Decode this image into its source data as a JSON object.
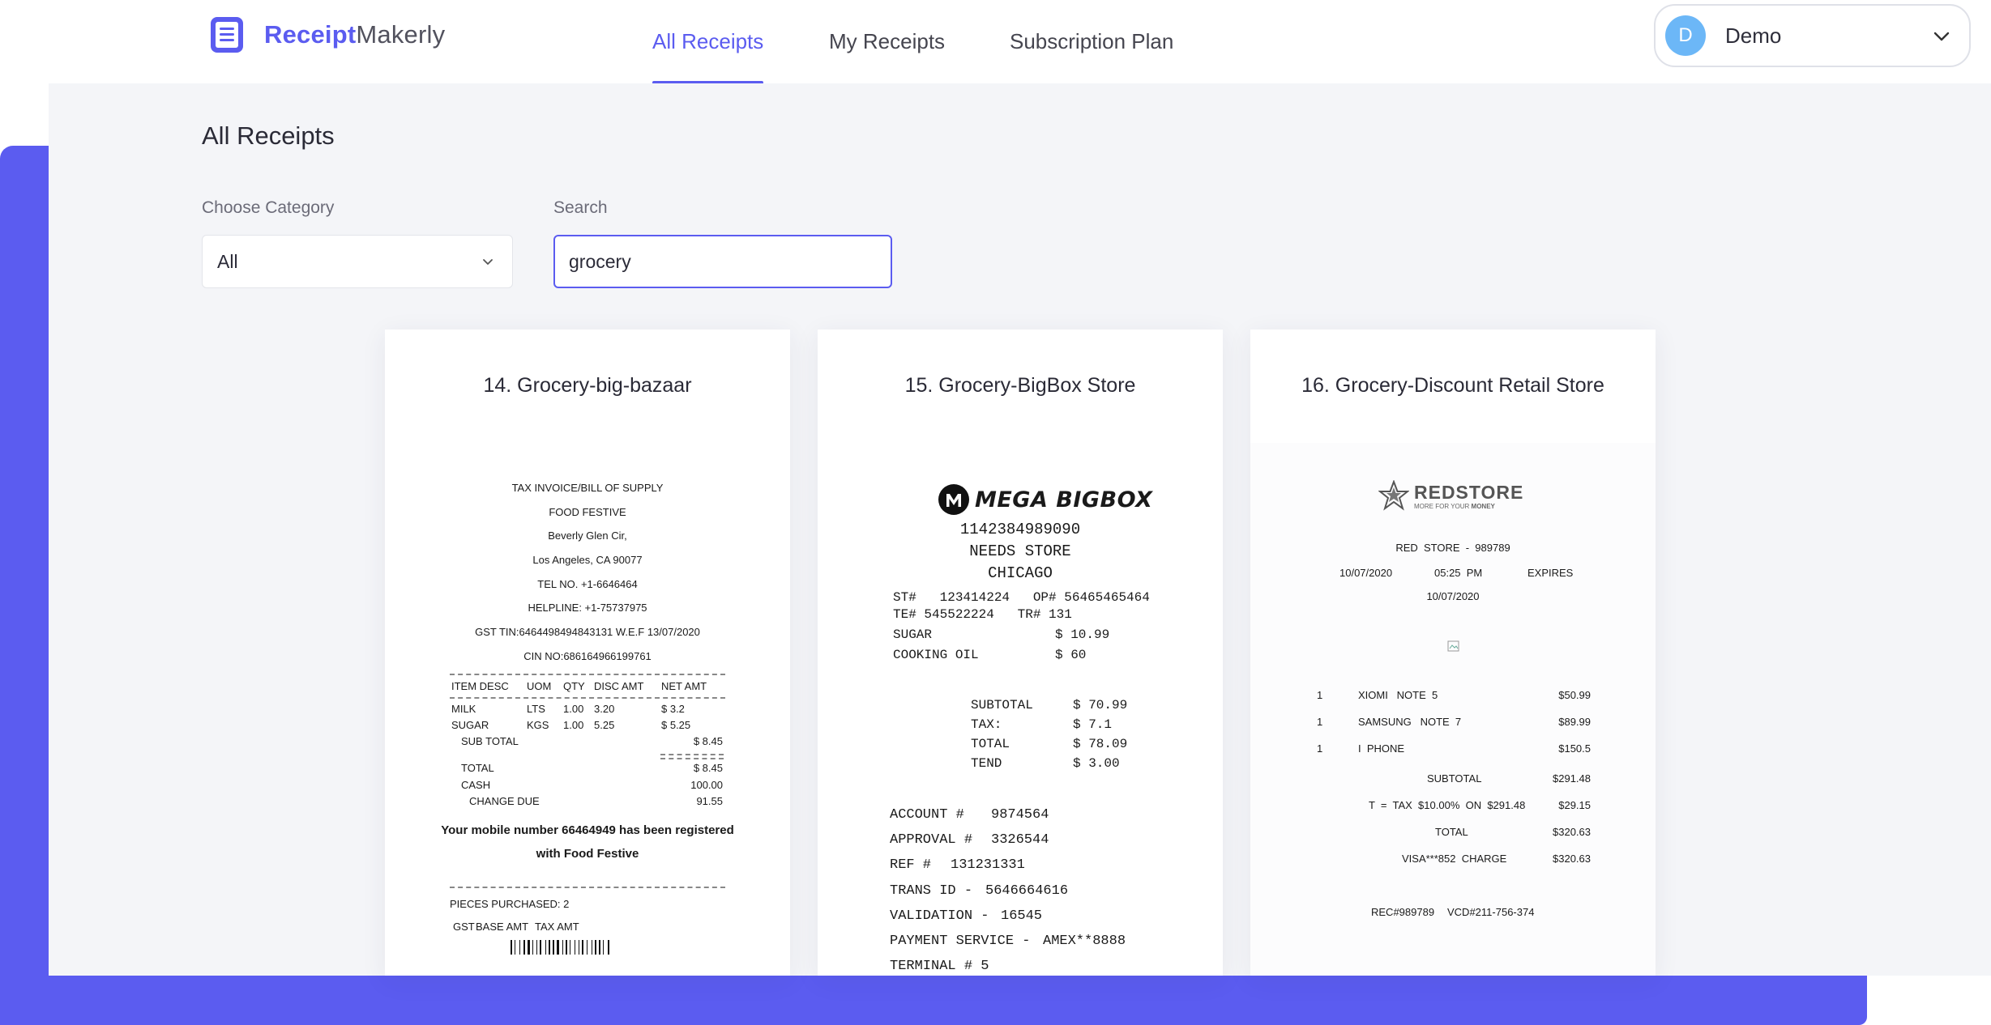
{
  "header": {
    "logo_bold": "Receipt",
    "logo_rest": "Makerly",
    "nav": [
      {
        "label": "All Receipts",
        "active": true
      },
      {
        "label": "My Receipts",
        "active": false
      },
      {
        "label": "Subscription Plan",
        "active": false
      }
    ],
    "user": {
      "initial": "D",
      "name": "Demo"
    }
  },
  "page": {
    "title": "All Receipts",
    "category_label": "Choose Category",
    "category_value": "All",
    "search_label": "Search",
    "search_value": "grocery"
  },
  "colors": {
    "accent": "#5b5cf0",
    "avatar": "#6cb7f7",
    "panel": "#f4f5f8"
  },
  "cards": [
    {
      "title": "14. Grocery-big-bazaar",
      "receipt": {
        "lines": [
          "TAX INVOICE/BILL OF SUPPLY",
          "FOOD FESTIVE",
          "Beverly Glen Cir,",
          "Los Angeles, CA 90077",
          "TEL NO. +1-6646464",
          "HELPLINE: +1-75737975",
          "GST TIN:6464498494843131 W.E.F 13/07/2020",
          "CIN NO:686164966199761"
        ],
        "cols": [
          "ITEM DESC",
          "UOM",
          "QTY",
          "DISC AMT",
          "NET AMT"
        ],
        "items": [
          {
            "desc": "MILK",
            "uom": "LTS",
            "qty": "1.00",
            "disc": "3.20",
            "net": "$ 3.2"
          },
          {
            "desc": "SUGAR",
            "uom": "KGS",
            "qty": "1.00",
            "disc": "5.25",
            "net": "$ 5.25"
          }
        ],
        "sub_total_label": "SUB TOTAL",
        "sub_total": "$ 8.45",
        "total_label": "TOTAL",
        "total": "$ 8.45",
        "cash_label": "CASH",
        "cash": "100.00",
        "change_label": "CHANGE DUE",
        "change": "91.55",
        "note1": "Your mobile number 66464949 has been registered",
        "note2": "with Food Festive",
        "pieces": "PIECES PURCHASED: 2",
        "gst_cols": [
          "GST",
          "BASE AMT",
          "TAX AMT"
        ]
      }
    },
    {
      "title": "15. Grocery-BigBox Store",
      "receipt": {
        "brand": "MEGA BIGBOX",
        "phone": "1142384989090",
        "store": "NEEDS STORE",
        "city": "CHICAGO",
        "ids1": "ST#   123414224   OP# 56465465464",
        "ids2": "TE# 545522224   TR# 131",
        "items": [
          {
            "name": "SUGAR",
            "price": "$ 10.99"
          },
          {
            "name": "COOKING OIL",
            "price": "$ 60"
          }
        ],
        "totals": [
          {
            "label": "SUBTOTAL",
            "value": "$ 70.99"
          },
          {
            "label": "TAX:",
            "value": "$ 7.1"
          },
          {
            "label": "TOTAL",
            "value": "$ 78.09"
          },
          {
            "label": "TEND",
            "value": "$ 3.00"
          }
        ],
        "refs": [
          {
            "label": "ACCOUNT #",
            "value": "9874564"
          },
          {
            "label": "APPROVAL #",
            "value": "3326544"
          },
          {
            "label": "REF #",
            "value": "131231331"
          },
          {
            "label": "TRANS ID -",
            "value": "5646664616"
          },
          {
            "label": "VALIDATION -",
            "value": "16545"
          },
          {
            "label": "PAYMENT SERVICE -",
            "value": "AMEX**8888"
          },
          {
            "label": "TERMINAL # 5",
            "value": ""
          }
        ]
      }
    },
    {
      "title": "16. Grocery-Discount Retail Store",
      "receipt": {
        "brand": "REDSTORE",
        "tagline_a": "MORE FOR YOUR ",
        "tagline_b": "MONEY",
        "store_line": "RED  STORE  -  989789",
        "date": "10/07/2020",
        "time": "05:25  PM",
        "expires": "EXPIRES",
        "expires_date": "10/07/2020",
        "items": [
          {
            "qty": "1",
            "name": "XIOMI   NOTE  5",
            "price": "$50.99"
          },
          {
            "qty": "1",
            "name": "SAMSUNG   NOTE  7",
            "price": "$89.99"
          },
          {
            "qty": "1",
            "name": "I  PHONE",
            "price": "$150.5"
          }
        ],
        "subtotal_label": "SUBTOTAL",
        "subtotal": "$291.48",
        "tax_label": "T  =  TAX  $10.00%  ON  $291.48",
        "tax": "$29.15",
        "total_label": "TOTAL",
        "total": "$320.63",
        "charge_label": "VISA***852  CHARGE",
        "charge": "$320.63",
        "rec": "REC#989789",
        "vcd": "VCD#211-756-374"
      }
    }
  ]
}
